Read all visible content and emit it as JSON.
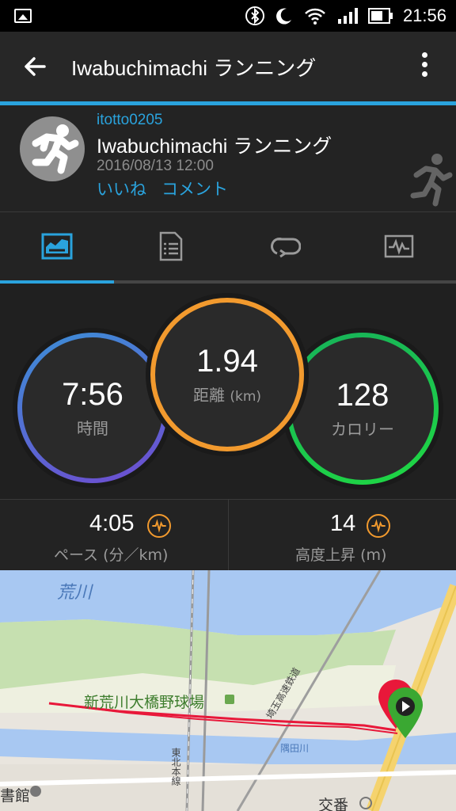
{
  "status_bar": {
    "time": "21:56",
    "icons": [
      "image-icon",
      "bluetooth-icon",
      "moon-icon",
      "wifi-icon",
      "signal-icon",
      "battery-icon"
    ]
  },
  "app_bar": {
    "title": "Iwabuchimachi ランニング",
    "back_icon": "arrow-left-icon",
    "menu_icon": "overflow-menu-icon"
  },
  "activity": {
    "username": "itotto0205",
    "name": "Iwabuchimachi ランニング",
    "datetime": "2016/08/13 12:00",
    "like_label": "いいね",
    "comment_label": "コメント"
  },
  "tabs": [
    {
      "icon": "summary-chart-icon",
      "active": true
    },
    {
      "icon": "details-list-icon",
      "active": false
    },
    {
      "icon": "laps-loop-icon",
      "active": false
    },
    {
      "icon": "graph-icon",
      "active": false
    }
  ],
  "stats": {
    "time": {
      "value": "7:56",
      "label": "時間"
    },
    "distance": {
      "value": "1.94",
      "label": "距離",
      "unit": "(km)"
    },
    "calories": {
      "value": "128",
      "label": "カロリー"
    }
  },
  "sub_stats": {
    "pace": {
      "value": "4:05",
      "label": "ペース",
      "unit": "(分／km)"
    },
    "elevation": {
      "value": "14",
      "label": "高度上昇",
      "unit": "(m)"
    }
  },
  "map": {
    "labels": {
      "river": "荒川",
      "park": "新荒川大橋野球場",
      "rail": "東北本線",
      "highway": "埼玉高速鉄道",
      "canal": "隅田川",
      "koban": "交番",
      "library": "書館"
    }
  },
  "colors": {
    "accent": "#2aa3dd",
    "time_ring": "#5a6fd6",
    "distance_ring": "#f29a2e",
    "calories_ring": "#1fd843",
    "track": "#e8183a"
  }
}
